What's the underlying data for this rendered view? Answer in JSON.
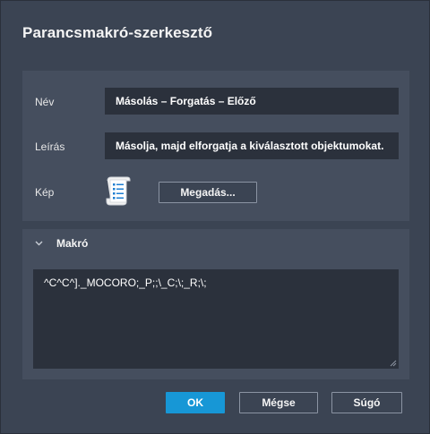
{
  "dialog": {
    "title": "Parancsmakró-szerkesztő"
  },
  "properties": {
    "name_label": "Név",
    "name_value": "Másolás – Forgatás – Előző",
    "description_label": "Leírás",
    "description_value": "Másolja, majd elforgatja a kiválasztott objektumokat.",
    "image_label": "Kép",
    "image_icon": "document-list-icon",
    "assign_button": "Megadás..."
  },
  "macro": {
    "header": "Makró",
    "value": "^C^C^]._MOCORO;_P;;\\_C;\\;_R;\\;"
  },
  "footer": {
    "ok": "OK",
    "cancel": "Mégse",
    "help": "Súgó"
  },
  "colors": {
    "background": "#3b4453",
    "panel": "#454e5e",
    "field": "#2b313c",
    "accent": "#1797d6"
  }
}
